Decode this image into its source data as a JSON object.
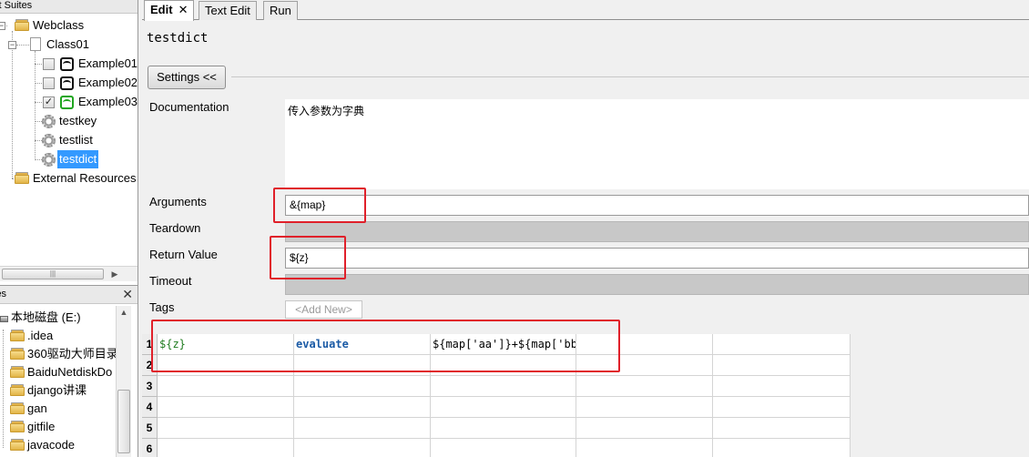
{
  "left": {
    "suites_header": "st Suites",
    "tree": [
      {
        "label": "Webclass",
        "icon": "folder-icon"
      },
      {
        "label": "Class01",
        "icon": "file-icon"
      },
      {
        "label": "Example01",
        "icon": "robot-icon",
        "checked": false
      },
      {
        "label": "Example02",
        "icon": "robot-icon",
        "checked": false
      },
      {
        "label": "Example03",
        "icon": "robot-icon",
        "checked": true
      },
      {
        "label": "testkey",
        "icon": "gear-icon"
      },
      {
        "label": "testlist",
        "icon": "gear-icon"
      },
      {
        "label": "testdict",
        "icon": "gear-icon",
        "selected": true
      },
      {
        "label": "External Resources",
        "icon": "folder-icon"
      }
    ],
    "files_header": "les",
    "files_close": "✕",
    "files": [
      {
        "label": "本地磁盘 (E:)",
        "icon": "drive-icon"
      },
      {
        "label": ".idea",
        "icon": "folder-icon"
      },
      {
        "label": "360驱动大师目录",
        "icon": "folder-icon"
      },
      {
        "label": "BaiduNetdiskDo",
        "icon": "folder-icon"
      },
      {
        "label": "django讲课",
        "icon": "folder-icon"
      },
      {
        "label": "gan",
        "icon": "folder-icon"
      },
      {
        "label": "gitfile",
        "icon": "folder-icon"
      },
      {
        "label": "javacode",
        "icon": "folder-icon"
      }
    ],
    "scroll_grip": "|||"
  },
  "tabs": [
    {
      "label": "Edit",
      "active": true,
      "close": "✕"
    },
    {
      "label": "Text Edit"
    },
    {
      "label": "Run"
    }
  ],
  "editor": {
    "title": "testdict",
    "settings_button": "Settings <<",
    "fields": {
      "documentation": {
        "label": "Documentation",
        "value": "传入参数为字典"
      },
      "arguments": {
        "label": "Arguments",
        "value": "&{map}"
      },
      "teardown": {
        "label": "Teardown"
      },
      "return_value": {
        "label": "Return Value",
        "value": "${z}"
      },
      "timeout": {
        "label": "Timeout"
      },
      "tags": {
        "label": "Tags",
        "add_new": "<Add New>"
      }
    },
    "grid": {
      "row_numbers": [
        "1",
        "2",
        "3",
        "4",
        "5",
        "6"
      ],
      "rows": [
        [
          "${z}",
          "evaluate",
          "${map['aa']}+${map['bb'",
          "",
          ""
        ]
      ]
    }
  },
  "colors": {
    "highlight": "#e0202a",
    "selection": "#3399ff",
    "variable": "#1e7b1e",
    "keyword": "#1a5aa5"
  }
}
